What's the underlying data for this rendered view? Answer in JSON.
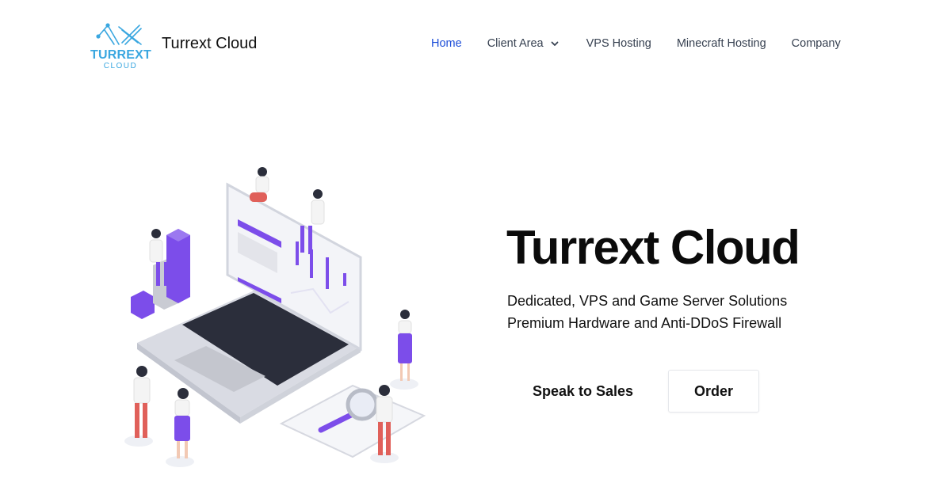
{
  "header": {
    "logo": {
      "word": "TURREXT",
      "sub": "CLOUD",
      "icon": "network-cross-icon",
      "color": "#3aa7e0"
    },
    "brand": "Turrext Cloud",
    "nav": [
      {
        "label": "Home",
        "active": true
      },
      {
        "label": "Client Area",
        "has_dropdown": true,
        "icon": "chevron-down-icon"
      },
      {
        "label": "VPS Hosting"
      },
      {
        "label": "Minecraft Hosting"
      },
      {
        "label": "Company"
      }
    ],
    "active_color": "#1d4ed8"
  },
  "hero": {
    "illustration": "isometric-laptop-team-illustration",
    "title": "Turrext Cloud",
    "subtitle_lines": [
      "Dedicated, VPS and Game Server Solutions",
      "Premium Hardware and Anti-DDoS Firewall"
    ],
    "buttons": {
      "sales": "Speak to Sales",
      "order": "Order"
    },
    "accent_purple": "#7c4dea"
  }
}
